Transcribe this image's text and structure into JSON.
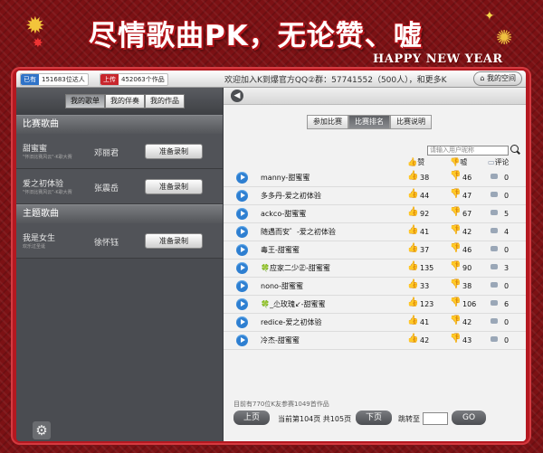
{
  "banner": {
    "title": "尽情歌曲PK，无论赞、嘘",
    "subtitle": "HAPPY NEW YEAR"
  },
  "topbar": {
    "chip1_tag": "已有",
    "chip1_value": "151683位达人",
    "chip2_tag": "上传",
    "chip2_value": "452063个作品",
    "welcome": "欢迎加入K到爆官方QQ②群：57741552（500人），和更多K",
    "myspace": "我的空间"
  },
  "left": {
    "tabs": [
      "我的歌单",
      "我的伴奏",
      "我的作品"
    ],
    "section1": "比赛歌曲",
    "section2": "主题歌曲",
    "record_label": "准备录制",
    "contest_songs": [
      {
        "title": "甜蜜蜜",
        "sub": "\"怀旧比赛风云\"-K歌大赛",
        "singer": "邓丽君"
      },
      {
        "title": "爱之初体验",
        "sub": "\"怀旧比赛风云\"-K歌大赛",
        "singer": "张震岳"
      }
    ],
    "theme_songs": [
      {
        "title": "我是女生",
        "sub": "欢乐过圣诞",
        "singer": "徐怀钰"
      }
    ]
  },
  "right": {
    "tabs": [
      "参加比赛",
      "比赛排名",
      "比赛说明"
    ],
    "search_placeholder": "请输入用户昵称",
    "col_like": "赞",
    "col_boo": "嘘",
    "col_comment": "评论",
    "entries": [
      {
        "name": "manny-甜蜜蜜",
        "likes": "38",
        "boos": "46",
        "comments": "0"
      },
      {
        "name": "多多丹-爱之初体验",
        "likes": "44",
        "boos": "47",
        "comments": "0"
      },
      {
        "name": "ackco-甜蜜蜜",
        "likes": "92",
        "boos": "67",
        "comments": "5"
      },
      {
        "name": "随遇而安゛-爱之初体验",
        "likes": "41",
        "boos": "42",
        "comments": "4"
      },
      {
        "name": "毒王-甜蜜蜜",
        "likes": "37",
        "boos": "46",
        "comments": "0"
      },
      {
        "name": "🍀应家二少㊣-甜蜜蜜",
        "likes": "135",
        "boos": "90",
        "comments": "3"
      },
      {
        "name": "nono-甜蜜蜜",
        "likes": "33",
        "boos": "38",
        "comments": "0"
      },
      {
        "name": "         🍀_尐玫瑰↙-甜蜜蜜",
        "likes": "123",
        "boos": "106",
        "comments": "6"
      },
      {
        "name": "redice-爱之初体验",
        "likes": "41",
        "boos": "42",
        "comments": "0"
      },
      {
        "name": "冷杰-甜蜜蜜",
        "likes": "42",
        "boos": "43",
        "comments": "0"
      }
    ],
    "footer_stats": "目前有770位K友参赛1049首作品",
    "prev": "上页",
    "page_info": "当前第104页 共105页",
    "next": "下页",
    "jump_label": "跳转至",
    "go": "GO"
  }
}
